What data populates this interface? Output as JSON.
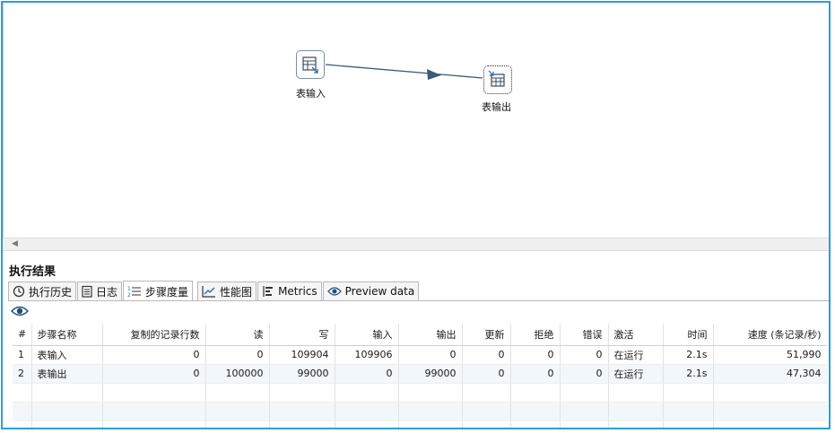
{
  "canvas": {
    "nodes": [
      {
        "label": "表输入",
        "icon": "table-input-icon"
      },
      {
        "label": "表输出",
        "icon": "table-output-icon"
      }
    ]
  },
  "panel": {
    "title": "执行结果",
    "tabs": [
      {
        "label": "执行历史",
        "icon": "history-icon"
      },
      {
        "label": "日志",
        "icon": "log-icon"
      },
      {
        "label": "步骤度量",
        "icon": "step-metrics-icon",
        "active": true
      },
      {
        "label": "性能图",
        "icon": "performance-chart-icon"
      },
      {
        "label": "Metrics",
        "icon": "metrics-icon"
      },
      {
        "label": "Preview data",
        "icon": "eye-icon"
      }
    ],
    "toolbar_icon": "eye-icon"
  },
  "table": {
    "headers": [
      "#",
      "步骤名称",
      "复制的记录行数",
      "读",
      "写",
      "输入",
      "输出",
      "更新",
      "拒绝",
      "错误",
      "激活",
      "时间",
      "速度 (条记录/秒)"
    ],
    "rows": [
      [
        "1",
        "表输入",
        "0",
        "0",
        "109904",
        "109906",
        "0",
        "0",
        "0",
        "0",
        "在运行",
        "2.1s",
        "51,990"
      ],
      [
        "2",
        "表输出",
        "0",
        "100000",
        "99000",
        "0",
        "99000",
        "0",
        "0",
        "0",
        "在运行",
        "2.1s",
        "47,304"
      ]
    ]
  }
}
